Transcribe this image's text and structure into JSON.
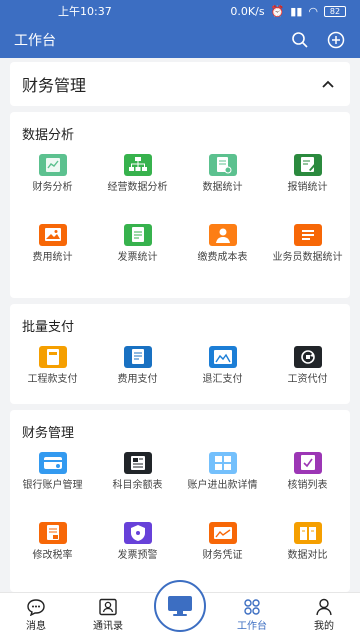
{
  "status_bar": {
    "time": "上午10:37",
    "speed": "0.0K/s",
    "battery": "82"
  },
  "header": {
    "title": "工作台"
  },
  "finance_header": {
    "title": "财务管理"
  },
  "cards": [
    {
      "title": "数据分析",
      "items": [
        {
          "label": "财务分析",
          "icon": "finance-analysis-icon",
          "color": "#5cc18f"
        },
        {
          "label": "经营数据分析",
          "icon": "org-chart-icon",
          "color": "#37b24d"
        },
        {
          "label": "数据统计",
          "icon": "doc-stat-icon",
          "color": "#5cc18f"
        },
        {
          "label": "报销统计",
          "icon": "edit-doc-icon",
          "color": "#2b8a3e"
        },
        {
          "label": "费用统计",
          "icon": "image-icon",
          "color": "#f76707"
        },
        {
          "label": "发票统计",
          "icon": "invoice-icon",
          "color": "#37b24d"
        },
        {
          "label": "缴费成本表",
          "icon": "person-icon",
          "color": "#fd7e14"
        },
        {
          "label": "业务员数据统计",
          "icon": "list-icon",
          "color": "#f76707"
        }
      ]
    },
    {
      "title": "批量支付",
      "items": [
        {
          "label": "工程款支付",
          "icon": "card-icon",
          "color": "#f59f00"
        },
        {
          "label": "费用支付",
          "icon": "doc-icon",
          "color": "#1971c2"
        },
        {
          "label": "退汇支付",
          "icon": "picture-icon",
          "color": "#1c7ed6"
        },
        {
          "label": "工资代付",
          "icon": "refresh-icon",
          "color": "#212529"
        }
      ]
    },
    {
      "title": "财务管理",
      "items": [
        {
          "label": "银行账户管理",
          "icon": "bank-card-icon",
          "color": "#339af0"
        },
        {
          "label": "科目余额表",
          "icon": "news-icon",
          "color": "#212529"
        },
        {
          "label": "账户进出款详情",
          "icon": "boxes-icon",
          "color": "#74c0fc"
        },
        {
          "label": "核销列表",
          "icon": "check-list-icon",
          "color": "#9c36b5"
        },
        {
          "label": "修改税率",
          "icon": "tax-doc-icon",
          "color": "#f76707"
        },
        {
          "label": "发票预警",
          "icon": "shield-icon",
          "color": "#6741d9"
        },
        {
          "label": "财务凭证",
          "icon": "voucher-icon",
          "color": "#f76707"
        },
        {
          "label": "数据对比",
          "icon": "book-icon",
          "color": "#f59f00"
        }
      ]
    }
  ],
  "bottom_nav": {
    "items": [
      {
        "label": "消息",
        "icon": "chat-icon"
      },
      {
        "label": "通讯录",
        "icon": "contacts-icon"
      },
      {
        "label": "工作台",
        "icon": "workbench-icon"
      },
      {
        "label": "我的",
        "icon": "user-icon"
      }
    ],
    "center_icon": "monitor-icon",
    "accent": "#3c6ec2"
  }
}
